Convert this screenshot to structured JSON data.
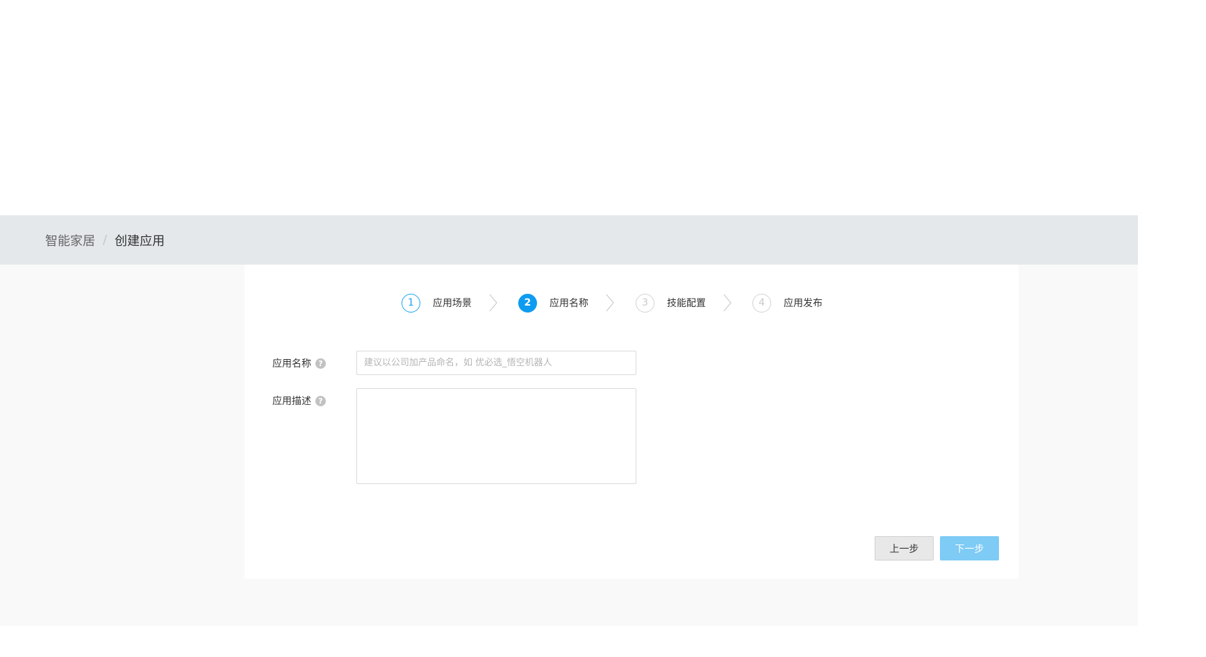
{
  "breadcrumb": {
    "parent": "智能家居",
    "separator": "/",
    "current": "创建应用"
  },
  "steps": [
    {
      "number": "1",
      "label": "应用场景",
      "state": "done"
    },
    {
      "number": "2",
      "label": "应用名称",
      "state": "active"
    },
    {
      "number": "3",
      "label": "技能配置",
      "state": "pending"
    },
    {
      "number": "4",
      "label": "应用发布",
      "state": "pending"
    }
  ],
  "form": {
    "name": {
      "label": "应用名称",
      "value": "",
      "placeholder": "建议以公司加产品命名，如 优必选_悟空机器人"
    },
    "description": {
      "label": "应用描述",
      "value": ""
    },
    "help_glyph": "?"
  },
  "buttons": {
    "prev_label": "上一步",
    "next_label": "下一步"
  },
  "colors": {
    "breadcrumb_bg": "#e4e8eb",
    "content_bg": "#f9f9f9",
    "accent": "#0e9cf0",
    "next_button_disabled": "#7ecbf5",
    "prev_button_bg": "#e8e8e8"
  },
  "icons": {
    "step_separator": "chevron-right-icon",
    "help": "question-circle-icon"
  }
}
